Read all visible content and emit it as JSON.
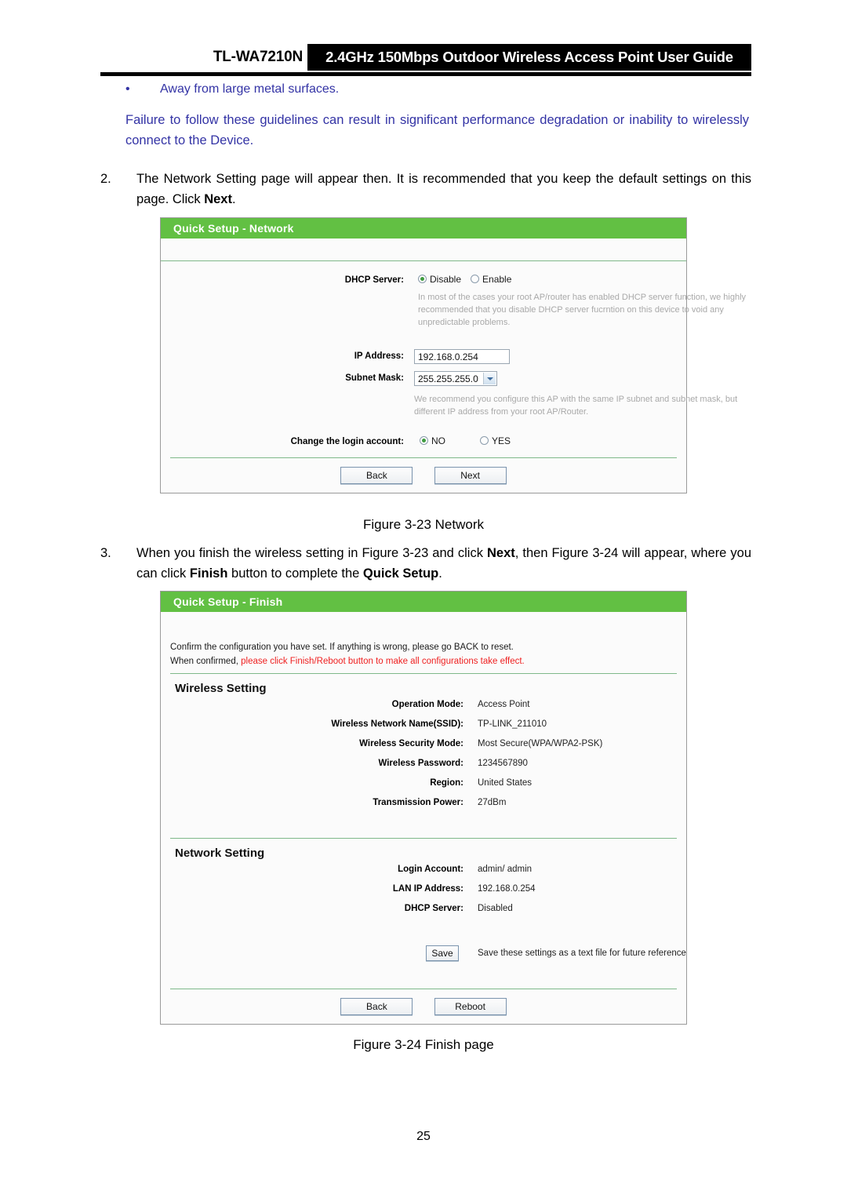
{
  "header": {
    "model": "TL-WA7210N",
    "title": "2.4GHz 150Mbps Outdoor Wireless Access Point User Guide"
  },
  "notice": {
    "bullet_glyph": "•",
    "bullet_text": "Away from large metal surfaces.",
    "paragraph": "Failure to follow these guidelines can result in significant performance degradation or inability to wirelessly connect to the Device.",
    "color": "#3333a5"
  },
  "steps": {
    "step2": {
      "number": "2.",
      "text_before": "The Network Setting page will appear then. It is recommended that you keep the default settings on this page. Click ",
      "bold": "Next",
      "text_after": "."
    },
    "step3": {
      "number": "3.",
      "p1": "When you finish the wireless setting in Figure 3-23 and click ",
      "b1": "Next",
      "p2": ", then Figure 3-24 will appear, where you can click ",
      "b2": "Finish",
      "p3": " button to complete the ",
      "b3": "Quick Setup",
      "p4": "."
    }
  },
  "captions": {
    "figure_23": "Figure 3-23 Network",
    "figure_24": "Figure 3-24 Finish page"
  },
  "page_number": "25",
  "panel_network": {
    "title": "Quick Setup - Network",
    "accent_color": "#62c043",
    "dhcp": {
      "label": "DHCP Server:",
      "options": [
        "Disable",
        "Enable"
      ],
      "selected": "Disable",
      "helper": "In most of the cases your root AP/router has enabled DHCP server function, we highly recommended that you disable DHCP server fucrntion on this device to void any unpredictable problems."
    },
    "ip_address": {
      "label": "IP Address:",
      "value": "192.168.0.254"
    },
    "subnet_mask": {
      "label": "Subnet Mask:",
      "value": "255.255.255.0",
      "helper": "We recommend you configure this AP with the same IP subnet and subnet mask, but different IP address from your root AP/Router."
    },
    "change_login": {
      "label": "Change the login account:",
      "options": [
        "NO",
        "YES"
      ],
      "selected": "NO"
    },
    "buttons": {
      "back": "Back",
      "next": "Next"
    }
  },
  "panel_finish": {
    "title": "Quick Setup - Finish",
    "confirm_line1": "Confirm the configuration you have set. If anything is wrong, please go BACK to reset.",
    "confirm_line2_prefix": "When confirmed, ",
    "confirm_line2_red": "please click Finish/Reboot button to make all configurations take effect.",
    "red_color": "#ef2020",
    "wireless_section": {
      "heading": "Wireless Setting",
      "rows": [
        {
          "key": "Operation Mode:",
          "value": "Access Point"
        },
        {
          "key": "Wireless Network Name(SSID):",
          "value": "TP-LINK_211010"
        },
        {
          "key": "Wireless Security Mode:",
          "value": "Most Secure(WPA/WPA2-PSK)"
        },
        {
          "key": "Wireless Password:",
          "value": "1234567890"
        },
        {
          "key": "Region:",
          "value": "United States"
        },
        {
          "key": "Transmission Power:",
          "value": "27dBm"
        }
      ]
    },
    "network_section": {
      "heading": "Network Setting",
      "rows": [
        {
          "key": "Login Account:",
          "value": "admin/ admin"
        },
        {
          "key": "LAN IP Address:",
          "value": "192.168.0.254"
        },
        {
          "key": "DHCP Server:",
          "value": "Disabled"
        }
      ]
    },
    "save": {
      "button": "Save",
      "note": "Save these settings as a text file for future reference"
    },
    "buttons": {
      "back": "Back",
      "reboot": "Reboot"
    }
  }
}
